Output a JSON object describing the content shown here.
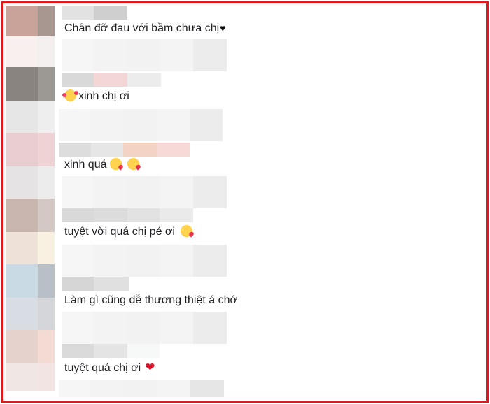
{
  "colors": {
    "frame_border": "#e5161b",
    "comment_text": "#1c1e21"
  },
  "comments": [
    {
      "text": "Chân đỡ đau với bầm chưa chị",
      "trailing": "black-heart-icon"
    },
    {
      "text": "xinh chị ơi",
      "leading": "smiling-face-with-hearts-icon"
    },
    {
      "text": "xinh quá",
      "trailing": "face-blowing-kiss-icon x2"
    },
    {
      "text": "tuyệt vời quá chị pé ơi",
      "trailing": "face-blowing-kiss-icon"
    },
    {
      "text": "Làm gì cũng dễ thương thiệt á chớ"
    },
    {
      "text": "tuyệt quá chị ơi",
      "trailing": "red-heart-icon"
    }
  ],
  "glyphs": {
    "black_heart": "♥",
    "red_heart": "❤"
  }
}
